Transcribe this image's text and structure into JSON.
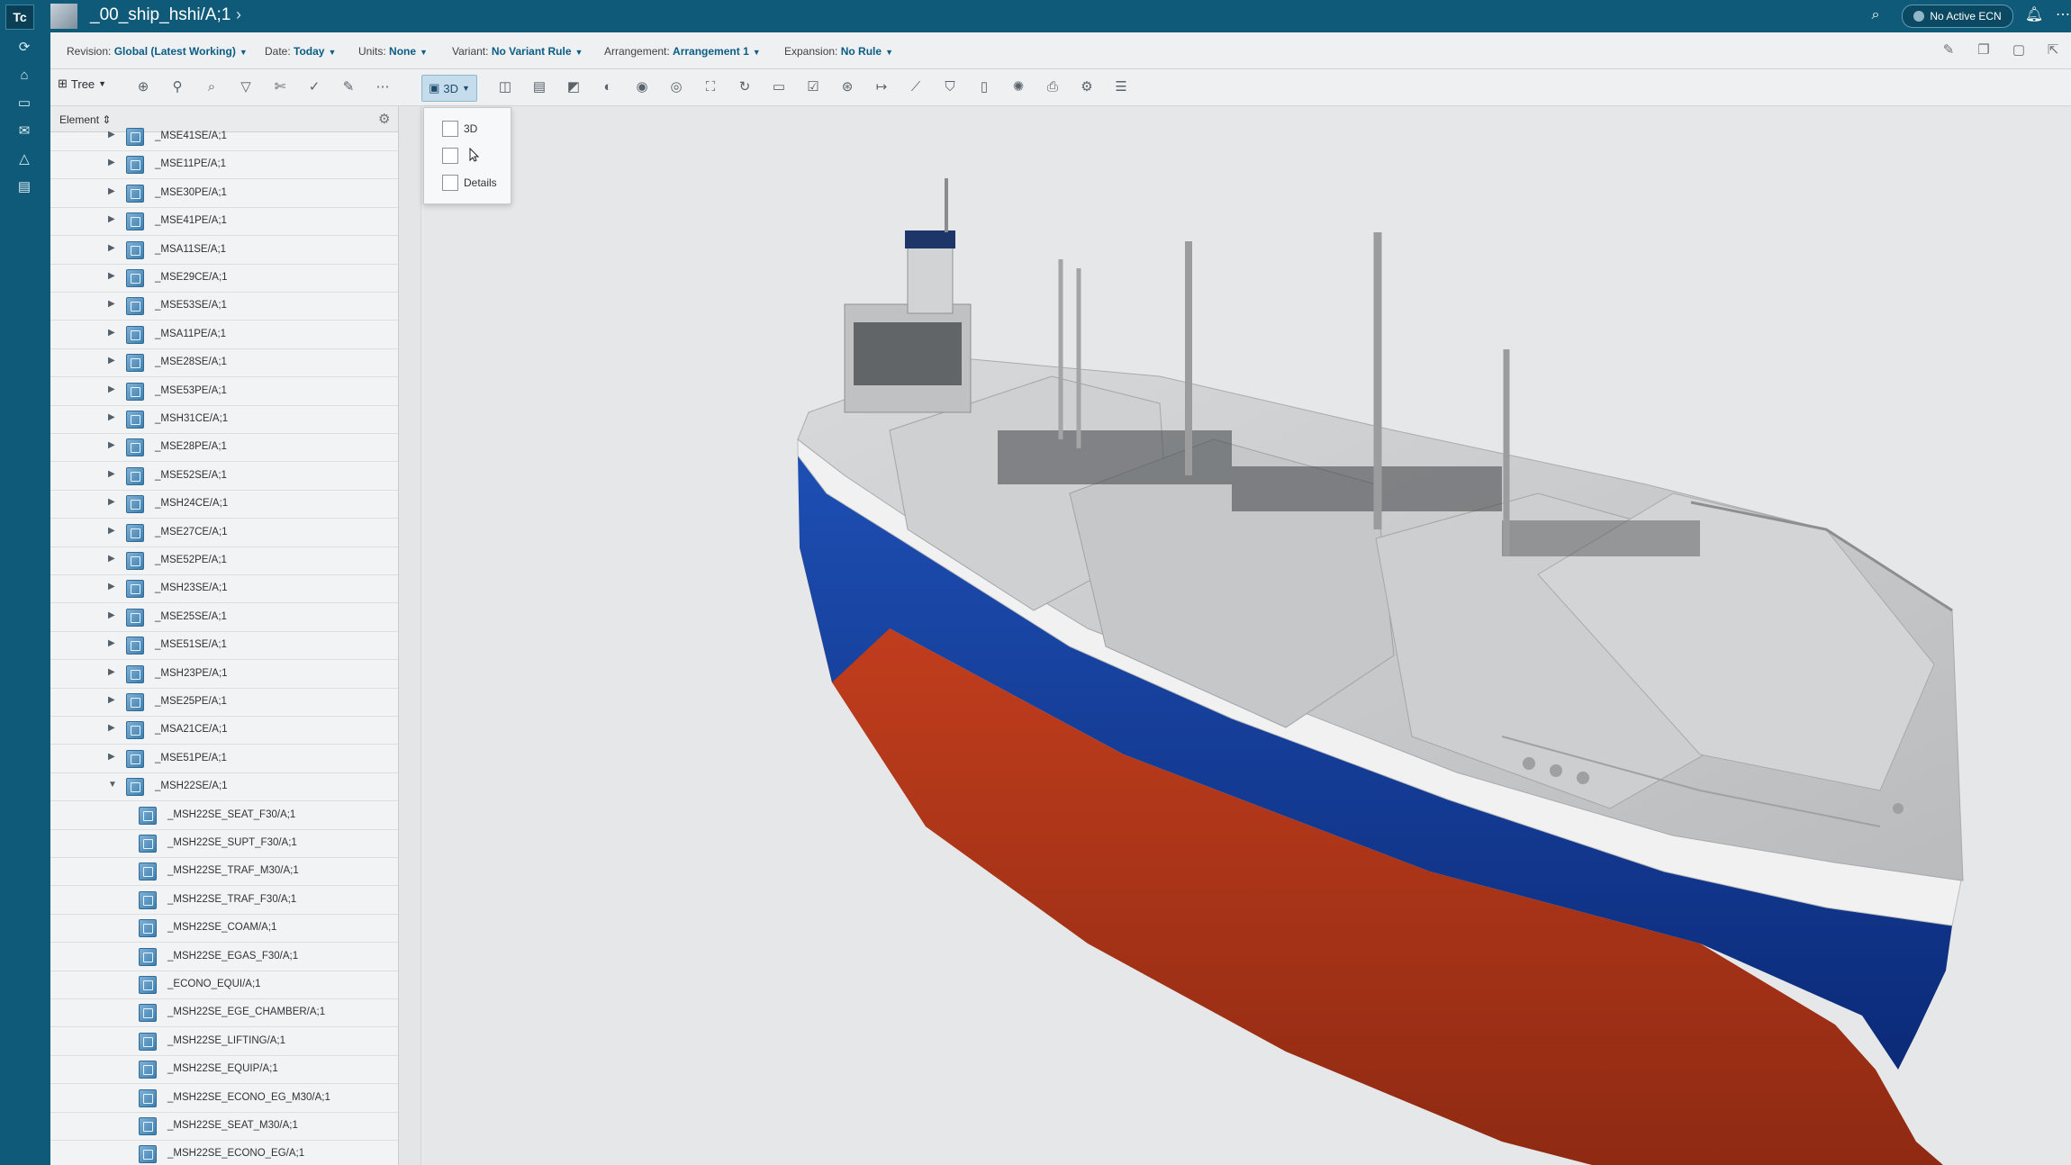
{
  "app": {
    "logo": "Tc",
    "title": "_00_ship_hshi/A;1",
    "ecn_label": "No Active ECN"
  },
  "revision_bar": {
    "items": [
      {
        "label": "Revision:",
        "value": "Global (Latest Working)"
      },
      {
        "label": "Date:",
        "value": "Today"
      },
      {
        "label": "Units:",
        "value": "None"
      },
      {
        "label": "Variant:",
        "value": "No Variant Rule"
      },
      {
        "label": "Arrangement:",
        "value": "Arrangement 1"
      },
      {
        "label": "Expansion:",
        "value": "No Rule"
      }
    ]
  },
  "toolbar": {
    "tree_label": "Tree",
    "view_label": "3D"
  },
  "panel": {
    "column_header": "Element"
  },
  "tree": [
    {
      "name": "_MSE41SE/A;1"
    },
    {
      "name": "_MSE11PE/A;1"
    },
    {
      "name": "_MSE30PE/A;1"
    },
    {
      "name": "_MSE41PE/A;1"
    },
    {
      "name": "_MSA11SE/A;1"
    },
    {
      "name": "_MSE29CE/A;1"
    },
    {
      "name": "_MSE53SE/A;1"
    },
    {
      "name": "_MSA11PE/A;1"
    },
    {
      "name": "_MSE28SE/A;1"
    },
    {
      "name": "_MSE53PE/A;1"
    },
    {
      "name": "_MSH31CE/A;1"
    },
    {
      "name": "_MSE28PE/A;1"
    },
    {
      "name": "_MSE52SE/A;1"
    },
    {
      "name": "_MSH24CE/A;1"
    },
    {
      "name": "_MSE27CE/A;1"
    },
    {
      "name": "_MSE52PE/A;1"
    },
    {
      "name": "_MSH23SE/A;1"
    },
    {
      "name": "_MSE25SE/A;1"
    },
    {
      "name": "_MSE51SE/A;1"
    },
    {
      "name": "_MSH23PE/A;1"
    },
    {
      "name": "_MSE25PE/A;1"
    },
    {
      "name": "_MSA21CE/A;1"
    },
    {
      "name": "_MSE51PE/A;1"
    },
    {
      "name": "_MSH22SE/A;1"
    },
    {
      "name": "_MSH22SE_SEAT_F30/A;1"
    },
    {
      "name": "_MSH22SE_SUPT_F30/A;1"
    },
    {
      "name": "_MSH22SE_TRAF_M30/A;1"
    },
    {
      "name": "_MSH22SE_TRAF_F30/A;1"
    },
    {
      "name": "_MSH22SE_COAM/A;1"
    },
    {
      "name": "_MSH22SE_EGAS_F30/A;1"
    },
    {
      "name": "_ECONO_EQUI/A;1"
    },
    {
      "name": "_MSH22SE_EGE_CHAMBER/A;1"
    },
    {
      "name": "_MSH22SE_LIFTING/A;1"
    },
    {
      "name": "_MSH22SE_EQUIP/A;1"
    },
    {
      "name": "_MSH22SE_ECONO_EG_M30/A;1"
    },
    {
      "name": "_MSH22SE_SEAT_M30/A;1"
    },
    {
      "name": "_MSH22SE_ECONO_EG/A;1"
    }
  ],
  "view_menu": {
    "items": [
      {
        "label": "3D"
      },
      {
        "label": ""
      },
      {
        "label": "Details"
      }
    ]
  },
  "colors": {
    "brand": "#0e5a78",
    "accent": "#0b5d85",
    "hull_blue": "#0f3a96",
    "hull_red": "#b5361a"
  }
}
